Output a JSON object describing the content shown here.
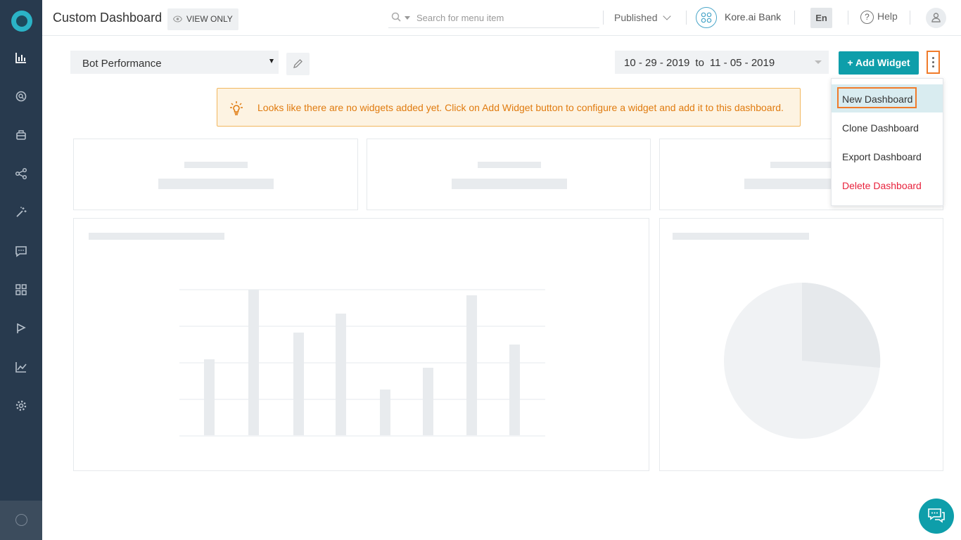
{
  "header": {
    "title": "Custom Dashboard",
    "view_only": "VIEW ONLY",
    "search_placeholder": "Search for menu item",
    "published": "Published",
    "bot_name": "Kore.ai Bank",
    "language": "En",
    "help": "Help"
  },
  "sidebar": {
    "icons": [
      "dashboard-icon",
      "search-chat-icon",
      "bot-icon",
      "flow-icon",
      "magic-wand-icon",
      "message-icon",
      "apps-grid-icon",
      "flag-icon",
      "analytics-icon",
      "settings-icon"
    ]
  },
  "toolbar": {
    "dashboard_select": "Bot Performance",
    "date_from": "10 - 29 - 2019",
    "date_sep": "to",
    "date_to": "11 - 05 - 2019",
    "add_widget": "+ Add Widget"
  },
  "menu": {
    "items": [
      {
        "label": "New Dashboard",
        "active": true
      },
      {
        "label": "Clone Dashboard"
      },
      {
        "label": "Export Dashboard"
      },
      {
        "label": "Delete Dashboard",
        "danger": true
      }
    ]
  },
  "banner": {
    "text": "Looks like there are no widgets added yet. Click on Add Widget button to configure a widget and add it to this dashboard."
  },
  "colors": {
    "sidebar": "#283a4e",
    "accent": "#0e9eaa",
    "highlight": "#f07b2a",
    "banner_text": "#e07b0f",
    "danger": "#e8223c"
  }
}
